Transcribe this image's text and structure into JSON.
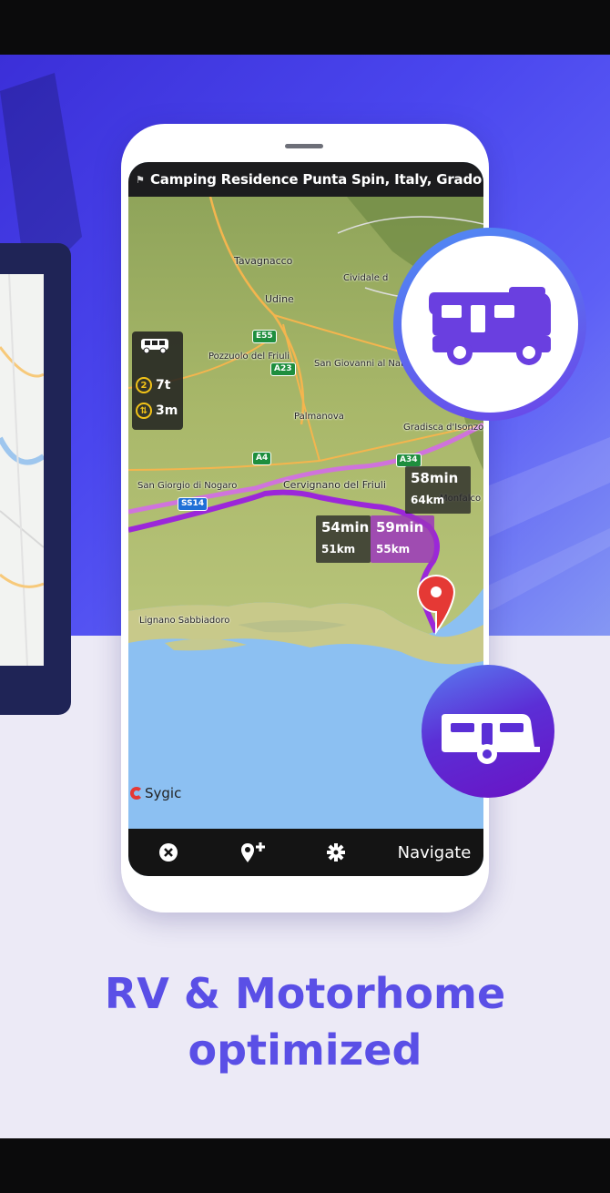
{
  "screen": {
    "destination_title": "Camping Residence Punta Spin, Italy, Grado",
    "flag_icon": "flag-icon"
  },
  "restrictions": {
    "weight_value": "7t",
    "weight_icon_label": "2",
    "height_value": "3m"
  },
  "map_labels": {
    "tavagnacco": "Tavagnacco",
    "udine": "Udine",
    "cividale": "Cividale d",
    "pozzuolo": "Pozzuolo del Friuli",
    "san_giovanni": "San Giovanni al Natiso",
    "palmanova": "Palmanova",
    "gradisca": "Gradisca d'Isonzo",
    "san_giorgio": "San Giorgio di Nogaro",
    "cervignano": "Cervignano del Friuli",
    "monfalcone": "Monfalco",
    "lignano": "Lignano Sabbiadoro"
  },
  "road_badges": {
    "e55": "E55",
    "a23": "A23",
    "a4": "A4",
    "a34": "A34",
    "ss14": "SS14"
  },
  "route_options": [
    {
      "time": "58min",
      "distance": "64km"
    },
    {
      "time": "54min",
      "distance": "51km"
    },
    {
      "time": "59min",
      "distance": "55km"
    }
  ],
  "branding": {
    "map_logo": "Sygic"
  },
  "bottom_bar": {
    "close_icon": "close-icon",
    "add_waypoint_icon": "add-waypoint-icon",
    "settings_icon": "gear-icon",
    "navigate_label": "Navigate"
  },
  "headline": {
    "line1": "RV & Motorhome",
    "line2": "optimized"
  },
  "colors": {
    "accent": "#5a4fe6",
    "route_primary": "#9b27d9",
    "route_alt": "#d36be8",
    "pin": "#e53935"
  }
}
